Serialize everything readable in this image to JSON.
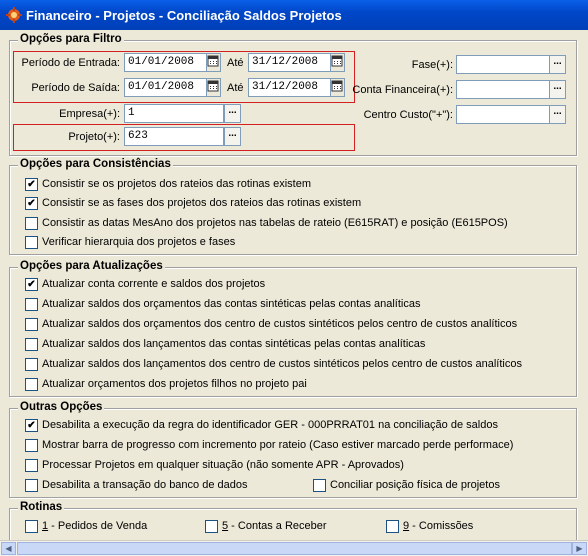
{
  "window": {
    "title": "Financeiro - Projetos - Conciliação Saldos Projetos"
  },
  "filter": {
    "title": "Opções para Filtro",
    "periodo_entrada_label": "Período de Entrada:",
    "periodo_entrada_de": "01/01/2008",
    "periodo_saida_label": "Período de Saída:",
    "periodo_saida_de": "01/01/2008",
    "ate_label": "Até",
    "periodo_entrada_ate": "31/12/2008",
    "periodo_saida_ate": "31/12/2008",
    "empresa_label": "Empresa(+):",
    "empresa_value": "1",
    "projeto_label": "Projeto(+):",
    "projeto_value": "623",
    "fase_label": "Fase(+):",
    "fase_value": "",
    "conta_label": "Conta Financeira(+):",
    "conta_value": "",
    "centro_label": "Centro Custo(\"+\"):",
    "centro_value": "",
    "lookup_glyph": "..."
  },
  "consistencias": {
    "title": "Opções para Consistências",
    "items": [
      {
        "label": "Consistir se os projetos dos rateios das rotinas existem",
        "checked": true
      },
      {
        "label": "Consistir se as fases dos projetos dos rateios das rotinas existem",
        "checked": true
      },
      {
        "label": "Consistir as datas MesAno dos projetos nas tabelas de rateio (E615RAT) e posição (E615POS)",
        "checked": false
      },
      {
        "label": "Verificar hierarquia dos projetos e fases",
        "checked": false
      }
    ]
  },
  "atualizacoes": {
    "title": "Opções para Atualizações",
    "items": [
      {
        "label": "Atualizar conta corrente e saldos dos projetos",
        "checked": true
      },
      {
        "label": "Atualizar saldos dos orçamentos das contas sintéticas pelas contas analíticas",
        "checked": false
      },
      {
        "label": "Atualizar saldos dos orçamentos dos centro de custos sintéticos pelos centro de custos analíticos",
        "checked": false
      },
      {
        "label": "Atualizar saldos dos lançamentos das contas sintéticas pelas contas analíticas",
        "checked": false
      },
      {
        "label": "Atualizar saldos dos lançamentos dos centro de custos sintéticos pelos centro de custos analíticos",
        "checked": false
      },
      {
        "label": "Atualizar orçamentos dos projetos filhos no projeto pai",
        "checked": false
      }
    ]
  },
  "outras": {
    "title": "Outras Opções",
    "items": [
      {
        "label": "Desabilita a execução da regra do identificador GER - 000PRRAT01 na conciliação de saldos",
        "checked": true
      },
      {
        "label": "Mostrar barra de progresso com incremento por rateio (Caso estiver marcado perde performace)",
        "checked": false
      },
      {
        "label": "Processar Projetos em qualquer situação (não somente APR - Aprovados)",
        "checked": false
      },
      {
        "label": "Desabilita a transação do banco de dados",
        "checked": false
      },
      {
        "label": "Conciliar posição física de projetos",
        "checked": false
      }
    ]
  },
  "rotinas": {
    "title": "Rotinas",
    "items": [
      {
        "num": "1",
        "label": " - Pedidos de Venda",
        "checked": false
      },
      {
        "num": "5",
        "label": " - Contas a Receber",
        "checked": false
      },
      {
        "num": "9",
        "label": " - Comissões",
        "checked": false
      }
    ]
  },
  "colors": {
    "titlebar": "#0047c8",
    "highlight_border": "#d32020",
    "window_bg": "#ece9d8"
  }
}
